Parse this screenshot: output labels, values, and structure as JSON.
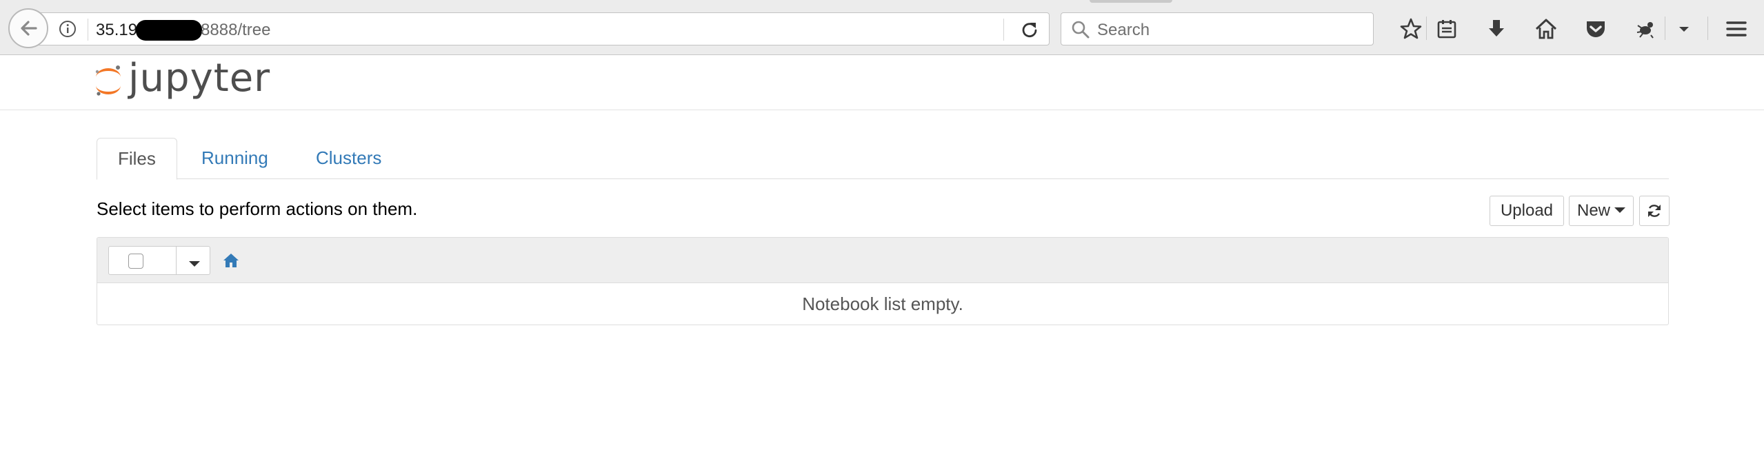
{
  "browser": {
    "url_host": "35.19",
    "url_rest": "8888/tree",
    "search_placeholder": "Search",
    "icons": [
      "back-arrow-icon",
      "info-icon",
      "reload-icon",
      "search-icon",
      "bookmark-star-icon",
      "reading-list-icon",
      "download-icon",
      "home-icon",
      "pocket-icon",
      "extension-icon",
      "overflow-chevron-icon",
      "hamburger-menu-icon"
    ]
  },
  "header": {
    "logo_text": "jupyter"
  },
  "tabs": [
    {
      "label": "Files",
      "active": true
    },
    {
      "label": "Running",
      "active": false
    },
    {
      "label": "Clusters",
      "active": false
    }
  ],
  "actions": {
    "hint": "Select items to perform actions on them.",
    "upload_label": "Upload",
    "new_label": "New"
  },
  "notebook_list": {
    "empty_message": "Notebook list empty."
  },
  "colors": {
    "link": "#337ab7",
    "jupyter_orange": "#f37726",
    "panel_header": "#eeeeee"
  }
}
